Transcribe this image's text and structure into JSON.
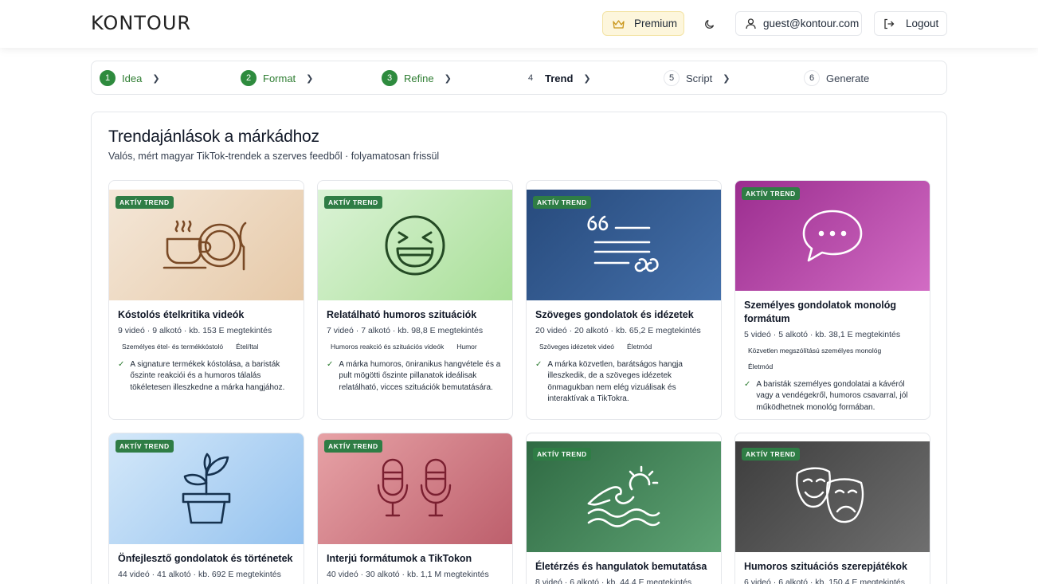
{
  "header": {
    "logo": "KONTOUR",
    "premium_label": "Premium",
    "user_email": "guest@kontour.com",
    "logout_label": "Logout"
  },
  "stepper": {
    "steps": [
      {
        "num": "1",
        "label": "Idea",
        "state": "done"
      },
      {
        "num": "2",
        "label": "Format",
        "state": "done"
      },
      {
        "num": "3",
        "label": "Refine",
        "state": "done"
      },
      {
        "num": "4",
        "label": "Trend",
        "state": "current"
      },
      {
        "num": "5",
        "label": "Script",
        "state": "todo"
      },
      {
        "num": "6",
        "label": "Generate",
        "state": "todo"
      }
    ]
  },
  "main": {
    "title": "Trendajánlások a márkádhoz",
    "subtitle": "Valós, mért magyar TikTok-trendek a szerves feedből · folyamatosan frissül",
    "badge_label": "AKTÍV TREND",
    "cards": [
      {
        "title": "Kóstolós ételkritika videók",
        "meta": "9 videó · 9 alkotó · kb. 153 E megtekintés",
        "tags": [
          "Személyes étel- és termékkóstoló",
          "Étel/Ital"
        ],
        "desc": "A signature termékek kóstolása, a baristák őszinte reakciói és a humoros tálalás tökéletesen illeszkedne a márka hangjához.",
        "icon": "coffee-plate-icon"
      },
      {
        "title": "Relatálható humoros szituációk",
        "meta": "7 videó · 7 alkotó · kb. 98,8 E megtekintés",
        "tags": [
          "Humoros reakció és szituációs videók",
          "Humor"
        ],
        "desc": "A márka humoros, öniranikus hangvétele és a pult mögötti őszinte pillanatok ideálisak relatálható, vicces szituációk bemutatására.",
        "icon": "laughing-face-icon"
      },
      {
        "title": "Szöveges gondolatok és idézetek",
        "meta": "20 videó · 20 alkotó · kb. 65,2 E megtekintés",
        "tags": [
          "Szöveges idézetek videó",
          "Életmód"
        ],
        "desc": "A márka közvetlen, barátságos hangja illeszkedik, de a szöveges idézetek önmagukban nem elég vizuálisak és interaktívak a TikTokra.",
        "icon": "quote-icon"
      },
      {
        "title": "Személyes gondolatok monológ formátum",
        "meta": "5 videó · 5 alkotó · kb. 38,1 E megtekintés",
        "tags": [
          "Közvetlen megszólítású személyes monológ",
          "Életmód"
        ],
        "desc": "A baristák személyes gondolatai a kávéról vagy a vendégekről, humoros csavarral, jól működhetnek monológ formában.",
        "icon": "speech-bubble-icon"
      },
      {
        "title": "Önfejlesztő gondolatok és történetek",
        "meta": "44 videó · 41 alkotó · kb. 692 E megtekintés",
        "icon": "potted-plant-icon"
      },
      {
        "title": "Interjú formátumok a TikTokon",
        "meta": "40 videó · 30 alkotó · kb. 1,1 M megtekintés",
        "icon": "microphones-icon"
      },
      {
        "title": "Életérzés és hangulatok bemutatása",
        "meta": "8 videó · 6 alkotó · kb. 44,4 E megtekintés",
        "icon": "sun-waves-icon"
      },
      {
        "title": "Humoros szituációs szerepjátékok",
        "meta": "6 videó · 6 alkotó · kb. 150,4 E megtekintés",
        "icon": "theater-masks-icon"
      }
    ]
  }
}
